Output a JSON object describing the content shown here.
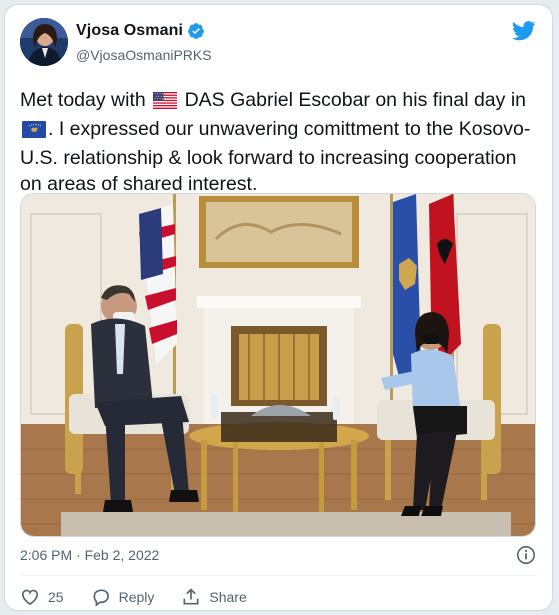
{
  "author": {
    "display_name": "Vjosa Osmani",
    "handle": "@VjosaOsmaniPRKS",
    "verified": true,
    "avatar_icon": "avatar-photo"
  },
  "platform_icon": "twitter-bird-icon",
  "tweet": {
    "text_part1": "Met today with",
    "text_part2": "DAS Gabriel Escobar on his final day in",
    "text_part3": ". I expressed our unwavering comittment to the Kosovo-U.S. relationship & look forward to increasing cooperation on areas of shared interest.",
    "emoji_1": "us-flag-emoji",
    "emoji_2": "kosovo-flag-emoji"
  },
  "media": {
    "type": "photo",
    "content": "meeting-photo"
  },
  "timestamp": "2:06 PM · Feb 2, 2022",
  "actions": {
    "like_count": "25",
    "reply_label": "Reply",
    "share_label": "Share"
  },
  "colors": {
    "brand": "#1d9bf0",
    "text": "#0f1419",
    "muted": "#536471"
  }
}
